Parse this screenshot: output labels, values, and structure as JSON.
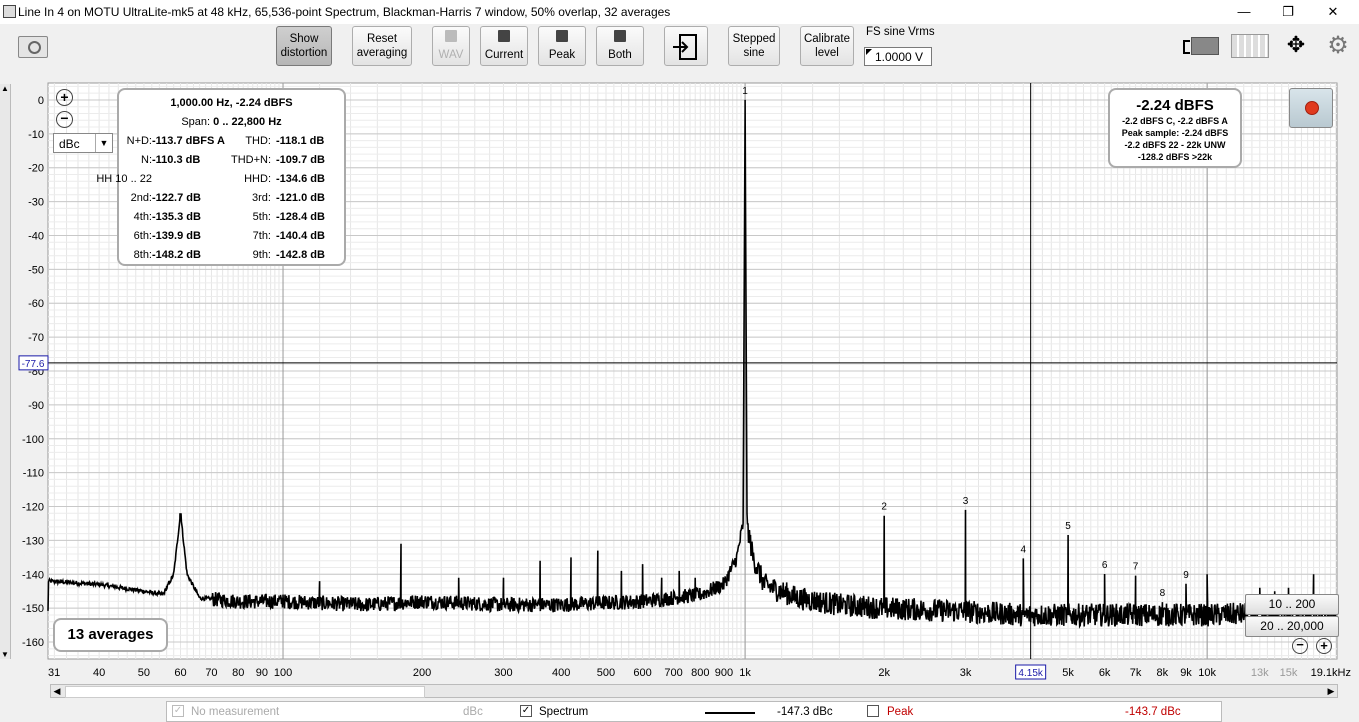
{
  "window": {
    "title": "Line In 4 on MOTU UltraLite-mk5 at 48 kHz, 65,536-point Spectrum, Blackman-Harris 7 window, 50% overlap, 32 averages",
    "minimize": "—",
    "maximize": "❐",
    "close": "✕"
  },
  "toolbar": {
    "show_distortion": [
      "Show",
      "distortion"
    ],
    "reset_averaging": [
      "Reset",
      "averaging"
    ],
    "wav": "WAV",
    "current": "Current",
    "peak": "Peak",
    "both": "Both",
    "stepped_sine": [
      "Stepped",
      "sine"
    ],
    "calibrate_level": [
      "Calibrate",
      "level"
    ],
    "fs_label": "FS sine Vrms",
    "fs_value": "1.0000 V"
  },
  "axis": {
    "unit": "dBc",
    "unit_select": "dBc",
    "cursor_y_value": "-77.6",
    "cursor_x_value": "4.15k"
  },
  "distortion_panel": {
    "header": "1,000.00 Hz, -2.24 dBFS",
    "span_label": "Span:",
    "span_value": "0 .. 22,800 Hz",
    "rows": [
      {
        "l_label": "N+D:",
        "l_value": "-113.7 dBFS A",
        "r_label": "THD:",
        "r_value": "-118.1 dB"
      },
      {
        "l_label": "N:",
        "l_value": "-110.3 dB",
        "r_label": "THD+N:",
        "r_value": "-109.7 dB"
      },
      {
        "l_label": "HH 10 .. 22",
        "l_value": "",
        "r_label": "HHD:",
        "r_value": "-134.6 dB"
      },
      {
        "l_label": "2nd:",
        "l_value": "-122.7 dB",
        "r_label": "3rd:",
        "r_value": "-121.0 dB"
      },
      {
        "l_label": "4th:",
        "l_value": "-135.3 dB",
        "r_label": "5th:",
        "r_value": "-128.4 dB"
      },
      {
        "l_label": "6th:",
        "l_value": "-139.9 dB",
        "r_label": "7th:",
        "r_value": "-140.4 dB"
      },
      {
        "l_label": "8th:",
        "l_value": "-148.2 dB",
        "r_label": "9th:",
        "r_value": "-142.8 dB"
      }
    ]
  },
  "level_panel": {
    "big": "-2.24 dBFS",
    "lines": [
      "-2.2 dBFS C, -2.2 dBFS A",
      "Peak sample: -2.24 dBFS",
      "-2.2 dBFS 22 - 22k UNW",
      "-128.2 dBFS >22k"
    ]
  },
  "averages_label": "13 averages",
  "range_buttons": [
    "10 .. 200",
    "20 .. 20,000"
  ],
  "status_bar": {
    "no_measurement": "No measurement",
    "no_measurement_unit": "dBc",
    "spectrum": "Spectrum",
    "spectrum_value": "-147.3 dBc",
    "peak": "Peak",
    "peak_value": "-143.7 dBc"
  },
  "colors": {
    "trace": "#000000",
    "peak_text": "#c00000",
    "cursor_box": "#1a1aa8",
    "record_button": "#e03a1e"
  },
  "chart_data": {
    "type": "line",
    "xscale": "log",
    "xlim": [
      31,
      19100
    ],
    "ylim": [
      -165,
      5
    ],
    "ylabel": "dBc",
    "x_ticks": [
      {
        "v": 31,
        "l": "31"
      },
      {
        "v": 40,
        "l": "40"
      },
      {
        "v": 50,
        "l": "50"
      },
      {
        "v": 60,
        "l": "60"
      },
      {
        "v": 70,
        "l": "70"
      },
      {
        "v": 80,
        "l": "80"
      },
      {
        "v": 90,
        "l": "90"
      },
      {
        "v": 100,
        "l": "100"
      },
      {
        "v": 200,
        "l": "200"
      },
      {
        "v": 300,
        "l": "300"
      },
      {
        "v": 400,
        "l": "400"
      },
      {
        "v": 500,
        "l": "500"
      },
      {
        "v": 600,
        "l": "600"
      },
      {
        "v": 700,
        "l": "700"
      },
      {
        "v": 800,
        "l": "800"
      },
      {
        "v": 900,
        "l": "900"
      },
      {
        "v": 1000,
        "l": "1k"
      },
      {
        "v": 2000,
        "l": "2k"
      },
      {
        "v": 3000,
        "l": "3k"
      },
      {
        "v": 5000,
        "l": "5k"
      },
      {
        "v": 6000,
        "l": "6k"
      },
      {
        "v": 7000,
        "l": "7k"
      },
      {
        "v": 8000,
        "l": "8k"
      },
      {
        "v": 9000,
        "l": "9k"
      },
      {
        "v": 10000,
        "l": "10k"
      },
      {
        "v": 13000,
        "l": "13k"
      },
      {
        "v": 15000,
        "l": "15k"
      },
      {
        "v": 19100,
        "l": "19.1kHz"
      }
    ],
    "y_ticks": [
      0,
      -10,
      -20,
      -30,
      -40,
      -50,
      -60,
      -70,
      -80,
      -90,
      -100,
      -110,
      -120,
      -130,
      -140,
      -150,
      -160
    ],
    "cursor": {
      "x": 4150,
      "y": -77.6
    },
    "harmonic_markers": [
      {
        "label": "1",
        "x": 1000,
        "y": 0
      },
      {
        "label": "2",
        "x": 2000,
        "y": -122.7
      },
      {
        "label": "3",
        "x": 3000,
        "y": -121.0
      },
      {
        "label": "4",
        "x": 4000,
        "y": -135.3
      },
      {
        "label": "5",
        "x": 5000,
        "y": -128.4
      },
      {
        "label": "6",
        "x": 6000,
        "y": -139.9
      },
      {
        "label": "7",
        "x": 7000,
        "y": -140.4
      },
      {
        "label": "8",
        "x": 8000,
        "y": -148.2
      },
      {
        "label": "9",
        "x": 9000,
        "y": -142.8
      }
    ],
    "series": [
      {
        "color": "#000000",
        "floor": [
          [
            31,
            -142
          ],
          [
            40,
            -143
          ],
          [
            50,
            -145
          ],
          [
            55,
            -146
          ],
          [
            58,
            -140
          ],
          [
            60,
            -122
          ],
          [
            62,
            -140
          ],
          [
            66,
            -147
          ],
          [
            80,
            -148
          ],
          [
            100,
            -148
          ],
          [
            150,
            -149
          ],
          [
            200,
            -148
          ],
          [
            300,
            -149
          ],
          [
            400,
            -149
          ],
          [
            600,
            -148
          ],
          [
            800,
            -146
          ],
          [
            900,
            -143
          ],
          [
            960,
            -135
          ],
          [
            990,
            -125
          ],
          [
            1000,
            0
          ],
          [
            1010,
            -125
          ],
          [
            1040,
            -135
          ],
          [
            1100,
            -143
          ],
          [
            1300,
            -147
          ],
          [
            1600,
            -149
          ],
          [
            2000,
            -150
          ],
          [
            3000,
            -151
          ],
          [
            4000,
            -152
          ],
          [
            6000,
            -152
          ],
          [
            10000,
            -152
          ],
          [
            19100,
            -151
          ]
        ],
        "spurs": [
          [
            60,
            -122
          ],
          [
            100,
            -146
          ],
          [
            120,
            -142
          ],
          [
            180,
            -131
          ],
          [
            240,
            -141
          ],
          [
            300,
            -141
          ],
          [
            360,
            -136
          ],
          [
            420,
            -135
          ],
          [
            480,
            -133
          ],
          [
            540,
            -139
          ],
          [
            600,
            -137
          ],
          [
            660,
            -141
          ],
          [
            720,
            -139
          ],
          [
            780,
            -141
          ],
          [
            2000,
            -122.7
          ],
          [
            3000,
            -121.0
          ],
          [
            4000,
            -135.3
          ],
          [
            5000,
            -128.4
          ],
          [
            6000,
            -139.9
          ],
          [
            7000,
            -140.4
          ],
          [
            8000,
            -148.2
          ],
          [
            9000,
            -142.8
          ],
          [
            10000,
            -140
          ],
          [
            13000,
            -144
          ],
          [
            14000,
            -145
          ],
          [
            15000,
            -144
          ],
          [
            17000,
            -140
          ],
          [
            19000,
            -146
          ]
        ]
      }
    ]
  }
}
